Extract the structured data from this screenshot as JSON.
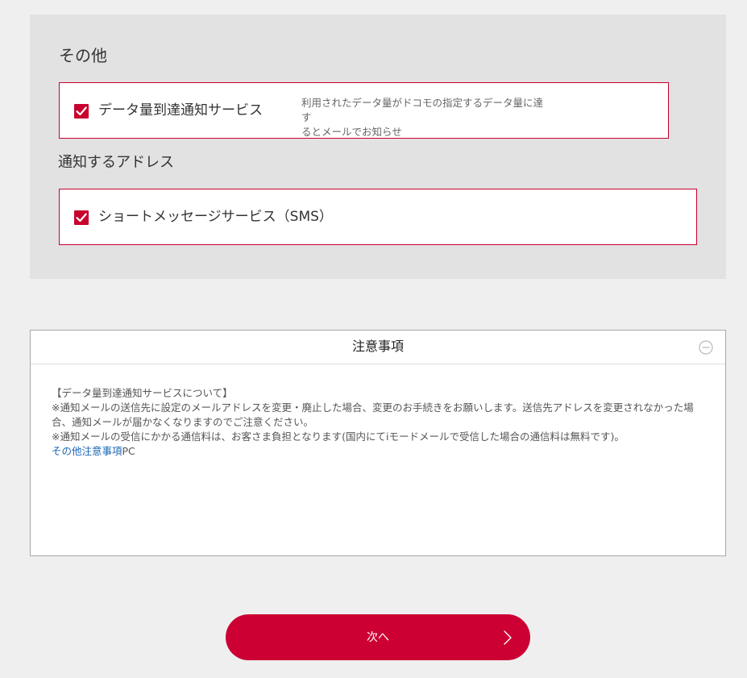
{
  "other_section": {
    "title": "その他",
    "data_notification": {
      "label": "データ量到達通知サービス",
      "checked": true,
      "description_line1": "利用されたデータ量がドコモの指定するデータ量に達す",
      "description_line2": "るとメールでお知らせ"
    }
  },
  "address_section": {
    "title": "通知するアドレス",
    "sms": {
      "label": "ショートメッセージサービス（SMS）",
      "checked": true
    }
  },
  "notice": {
    "title": "注意事項",
    "line1": "【データ量到達通知サービスについて】",
    "line2": "※通知メールの送信先に設定のメールアドレスを変更・廃止した場合、変更のお手続きをお願いします。送信先アドレスを変更されなかった場合、通知メールが届かなくなりますのでご注意ください。",
    "line3": "※通知メールの受信にかかる通信料は、お客さま負担となります(国内にてiモードメールで受信した場合の通信料は無料です)。",
    "link_text": "その他注意事項",
    "link_suffix": "PC"
  },
  "next_button": {
    "label": "次へ"
  },
  "colors": {
    "accent": "#cc0033",
    "link": "#1a66b5",
    "panel_background": "#e2e2e2",
    "page_background": "#efefef"
  },
  "icons": {
    "checkbox": "checkmark-icon",
    "collapse": "minus-circle-icon",
    "next": "chevron-right-icon"
  }
}
